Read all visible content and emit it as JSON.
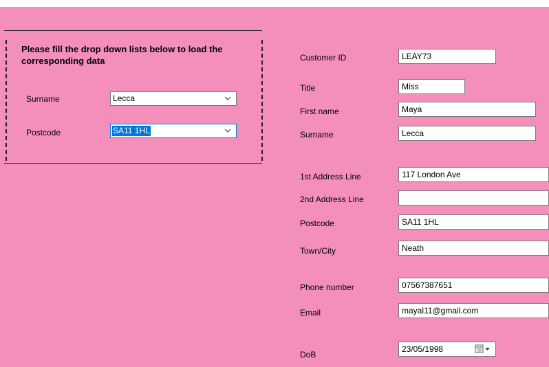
{
  "search_group": {
    "title": "Please fill the drop down lists below to load the corresponding data",
    "surname_label": "Surname",
    "surname_value": "Lecca",
    "postcode_label": "Postcode",
    "postcode_value": "SA11 1HL"
  },
  "details": {
    "customer_id": {
      "label": "Customer ID",
      "value": "LEAY73"
    },
    "title": {
      "label": "Title",
      "value": "Miss"
    },
    "first_name": {
      "label": "First name",
      "value": "Maya"
    },
    "surname": {
      "label": "Surname",
      "value": "Lecca"
    },
    "address1": {
      "label": "1st Address Line",
      "value": "117 London Ave"
    },
    "address2": {
      "label": "2nd Address Line",
      "value": ""
    },
    "postcode": {
      "label": "Postcode",
      "value": "SA11 1HL"
    },
    "town": {
      "label": "Town/City",
      "value": "Neath"
    },
    "phone": {
      "label": "Phone number",
      "value": "07567387651"
    },
    "email": {
      "label": "Email",
      "value": "mayal11@gmail.com"
    },
    "dob": {
      "label": "DoB",
      "value": "23/05/1998"
    }
  },
  "colors": {
    "form_background": "#f48fbb",
    "selection": "#0078d7"
  },
  "icons": {
    "dropdown": "chevron-down-icon",
    "date_picker": "calendar-icon"
  }
}
